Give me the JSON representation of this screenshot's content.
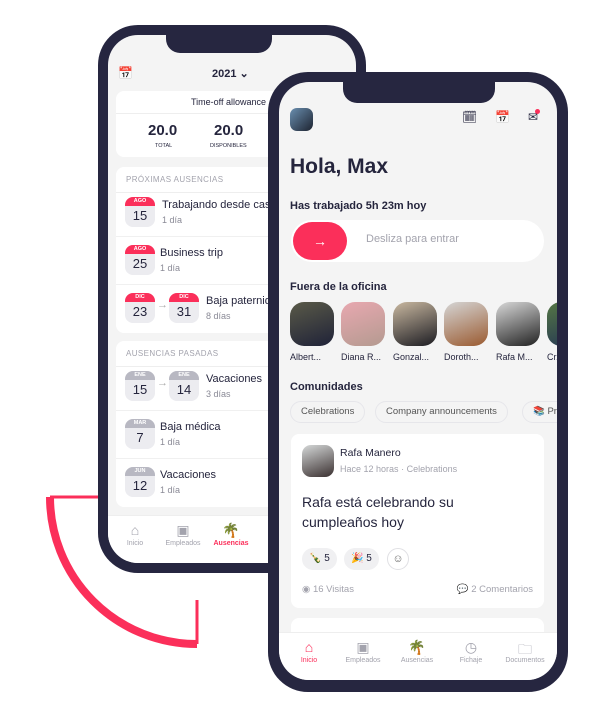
{
  "colors": {
    "accent": "#fb2f5a",
    "frame": "#262640",
    "bg": "#f4f4f4"
  },
  "back_phone": {
    "year": "2021",
    "allowance": {
      "title": "Time-off allowance",
      "total": "20.0",
      "total_label": "TOTAL",
      "available": "20.0",
      "available_label": "DISPONIBLES"
    },
    "upcoming": {
      "title": "PRÓXIMAS AUSENCIAS",
      "items": [
        {
          "month": "AGO",
          "day": "15",
          "title": "Trabajando desde casa",
          "duration": "1 día"
        },
        {
          "month": "AGO",
          "day": "25",
          "title": "Business trip",
          "duration": "1 día"
        },
        {
          "month": "DIC",
          "day": "23",
          "end_month": "DIC",
          "end_day": "31",
          "title": "Baja paternidad",
          "duration": "8 días"
        }
      ]
    },
    "past": {
      "title": "AUSENCIAS PASADAS",
      "items": [
        {
          "month": "ENE",
          "day": "15",
          "end_month": "ENE",
          "end_day": "14",
          "title": "Vacaciones",
          "duration": "3 días"
        },
        {
          "month": "MAR",
          "day": "7",
          "title": "Baja médica",
          "duration": "1 día"
        },
        {
          "month": "JUN",
          "day": "12",
          "title": "Vacaciones",
          "duration": "1 día"
        }
      ]
    },
    "tabs": [
      {
        "label": "Inicio",
        "icon": "home-icon"
      },
      {
        "label": "Empleados",
        "icon": "employees-icon"
      },
      {
        "label": "Ausencias",
        "icon": "palm-tree-icon",
        "active": true
      }
    ]
  },
  "front_phone": {
    "greeting": "Hola, Max",
    "worked": "Has trabajado 5h 23m hoy",
    "slide_label": "Desliza para entrar",
    "out_of_office": {
      "title": "Fuera de la oficina",
      "people": [
        "Albert...",
        "Diana R...",
        "Gonzal...",
        "Doroth...",
        "Rafa M...",
        "Cr..."
      ]
    },
    "communities": {
      "title": "Comunidades",
      "chips": [
        "Celebrations",
        "Company announcements",
        "📚 Pro..."
      ]
    },
    "post": {
      "author": "Rafa Manero",
      "time": "Hace 12 horas",
      "community": "Celebrations",
      "separator": "·",
      "text": "Rafa está celebrando su cumpleaños hoy",
      "reactions": [
        {
          "emoji": "🍾",
          "count": "5"
        },
        {
          "emoji": "🎉",
          "count": "5"
        }
      ],
      "views": "16 Visitas",
      "comments": "2 Comentarios"
    },
    "tabs": [
      {
        "label": "Inicio",
        "icon": "home-icon",
        "active": true
      },
      {
        "label": "Empleados",
        "icon": "employees-icon"
      },
      {
        "label": "Ausencias",
        "icon": "palm-tree-icon"
      },
      {
        "label": "Fichaje",
        "icon": "clock-icon"
      },
      {
        "label": "Documentos",
        "icon": "documents-icon"
      }
    ]
  }
}
